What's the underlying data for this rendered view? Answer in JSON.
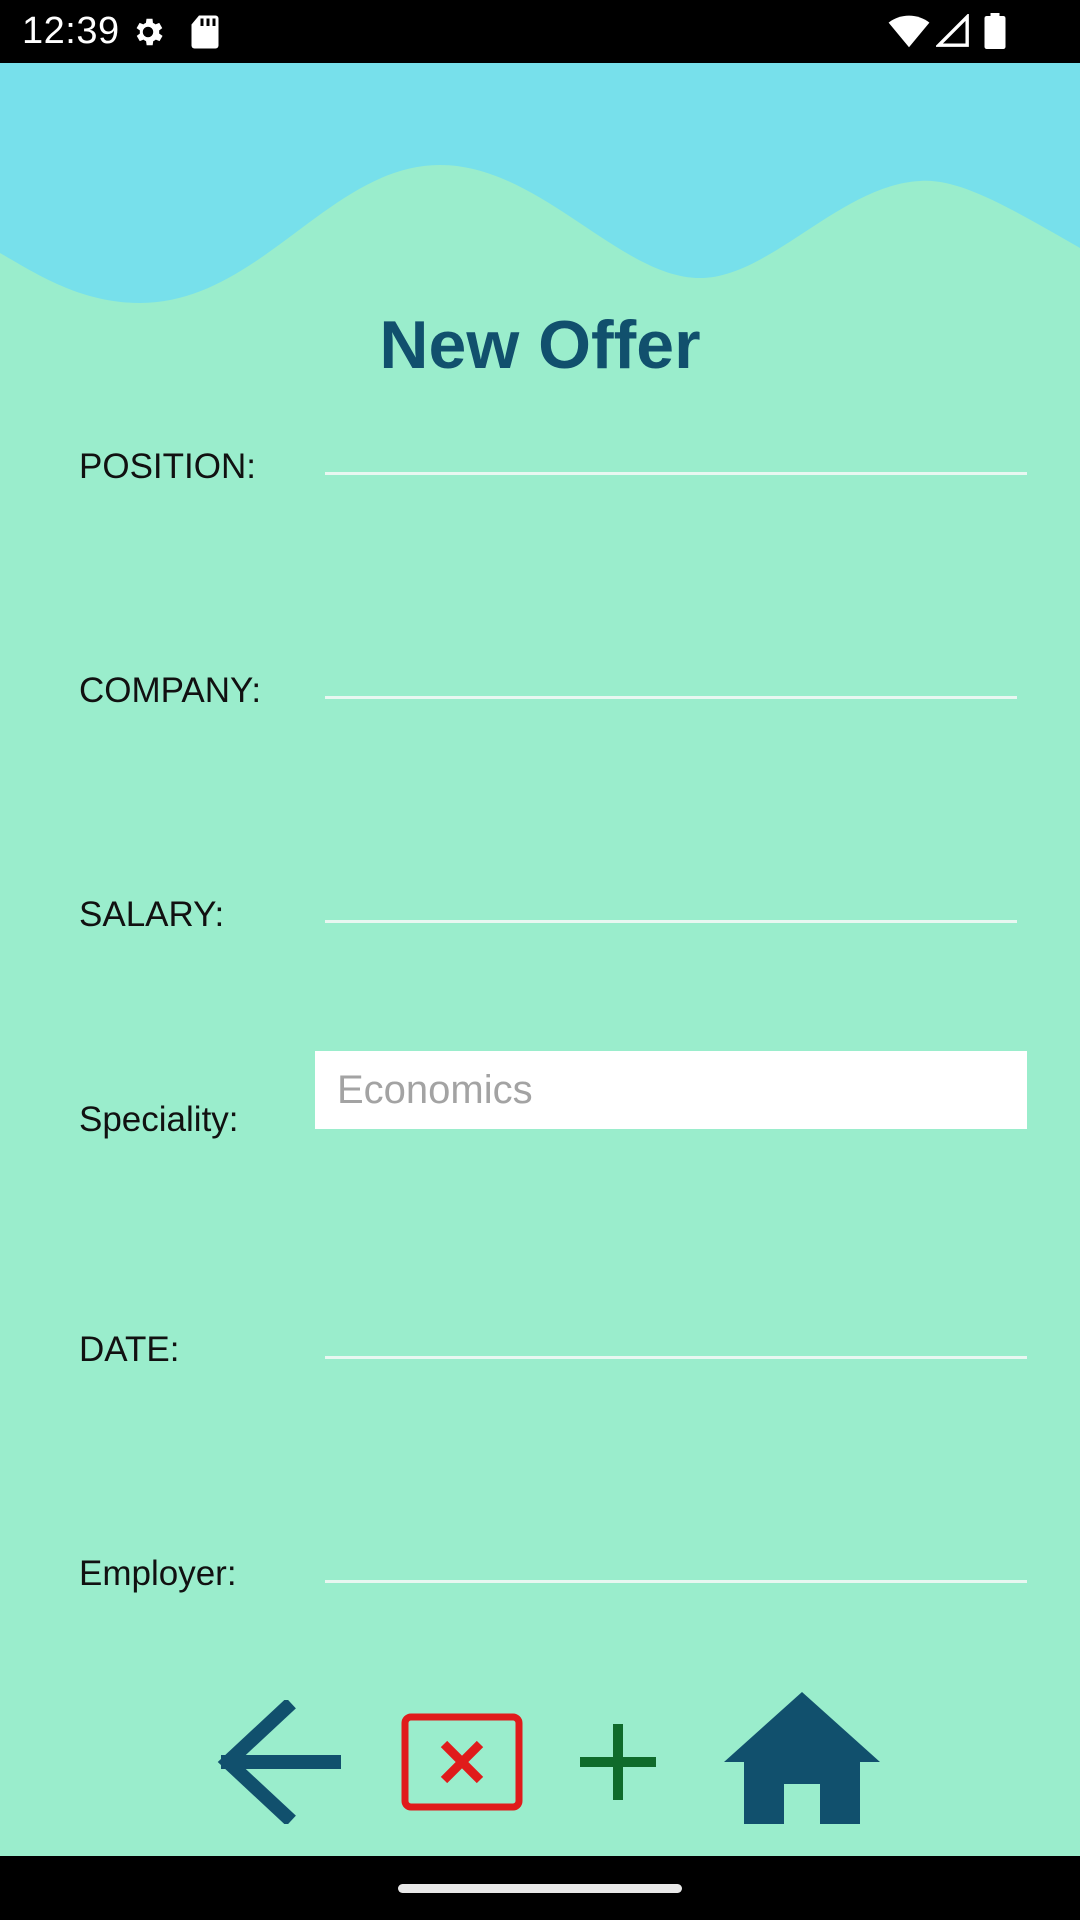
{
  "status_bar": {
    "time": "12:39",
    "icons": [
      "settings-icon",
      "sd-card-icon",
      "wifi-icon",
      "signal-icon",
      "battery-icon"
    ]
  },
  "page": {
    "title": "New Offer"
  },
  "form": {
    "position_label": "POSITION:",
    "position_value": "",
    "company_label": "COMPANY:",
    "company_value": "",
    "salary_label": "SALARY:",
    "salary_value": "",
    "speciality_label": "Speciality:",
    "speciality_value": "Economics",
    "date_label": "DATE:",
    "date_value": "",
    "employer_label": "Employer:",
    "employer_value": ""
  },
  "actions": {
    "icons": [
      "back-arrow-icon",
      "cancel-icon",
      "add-icon",
      "home-icon"
    ]
  },
  "colors": {
    "background": "#9aedcc",
    "wave": "#77e0eb",
    "title": "#11506d",
    "cancel": "#e01b1b",
    "add": "#0f6b2b"
  }
}
